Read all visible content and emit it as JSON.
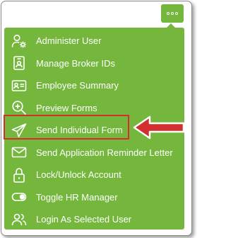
{
  "more_button": {
    "icon": "ellipsis-icon"
  },
  "menu": {
    "items": [
      {
        "label": "Administer User",
        "icon": "user-gear-icon"
      },
      {
        "label": "Manage Broker IDs",
        "icon": "id-badge-icon"
      },
      {
        "label": "Employee Summary",
        "icon": "id-card-icon"
      },
      {
        "label": "Preview Forms",
        "icon": "zoom-in-icon"
      },
      {
        "label": "Send Individual Form",
        "icon": "paper-plane-icon",
        "highlighted": true
      },
      {
        "label": "Send Application Reminder Letter",
        "icon": "envelope-icon"
      },
      {
        "label": "Lock/Unlock Account",
        "icon": "lock-icon"
      },
      {
        "label": "Toggle HR Manager",
        "icon": "toggle-icon"
      },
      {
        "label": "Login As Selected User",
        "icon": "users-icon"
      }
    ]
  },
  "colors": {
    "menu_bg": "#74b73c",
    "menu_text": "#ffffff",
    "highlight": "#d32f2f"
  }
}
